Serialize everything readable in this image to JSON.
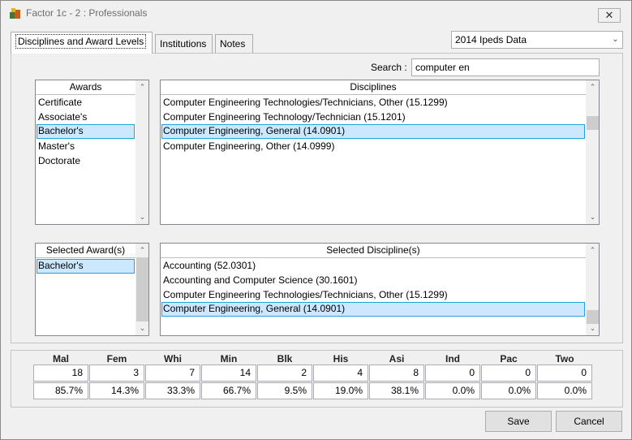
{
  "window": {
    "title": "Factor 1c - 2 : Professionals",
    "close_icon": "close-icon"
  },
  "tabs": [
    {
      "label": "Disciplines and Award Levels",
      "active": true
    },
    {
      "label": "Institutions",
      "active": false
    },
    {
      "label": "Notes",
      "active": false
    }
  ],
  "dataset": {
    "selected": "2014 Ipeds Data"
  },
  "search": {
    "label": "Search :",
    "value": "computer en"
  },
  "awards": {
    "header": "Awards",
    "items": [
      "Certificate",
      "Associate's",
      "Bachelor's",
      "Master's",
      "Doctorate"
    ],
    "selected_index": 2
  },
  "disciplines": {
    "header": "Disciplines",
    "items": [
      "Computer Engineering Technologies/Technicians, Other (15.1299)",
      "Computer Engineering Technology/Technician (15.1201)",
      "Computer Engineering, General (14.0901)",
      "Computer Engineering, Other (14.0999)"
    ],
    "selected_index": 2
  },
  "selected_awards": {
    "header": "Selected Award(s)",
    "items": [
      "Bachelor's"
    ],
    "selected_index": 0
  },
  "selected_disciplines": {
    "header": "Selected Discipline(s)",
    "items": [
      "Accounting (52.0301)",
      "Accounting and Computer Science (30.1601)",
      "Computer Engineering Technologies/Technicians, Other (15.1299)",
      "Computer Engineering, General (14.0901)"
    ],
    "selected_index": 3
  },
  "stats": [
    {
      "label": "Mal",
      "count": "18",
      "pct": "85.7%"
    },
    {
      "label": "Fem",
      "count": "3",
      "pct": "14.3%"
    },
    {
      "label": "Whi",
      "count": "7",
      "pct": "33.3%"
    },
    {
      "label": "Min",
      "count": "14",
      "pct": "66.7%"
    },
    {
      "label": "Blk",
      "count": "2",
      "pct": "9.5%"
    },
    {
      "label": "His",
      "count": "4",
      "pct": "19.0%"
    },
    {
      "label": "Asi",
      "count": "8",
      "pct": "38.1%"
    },
    {
      "label": "Ind",
      "count": "0",
      "pct": "0.0%"
    },
    {
      "label": "Pac",
      "count": "0",
      "pct": "0.0%"
    },
    {
      "label": "Two",
      "count": "0",
      "pct": "0.0%"
    }
  ],
  "buttons": {
    "save": "Save",
    "cancel": "Cancel"
  },
  "colors": {
    "selection_bg": "#cce8ff",
    "selection_border": "#26a0da"
  }
}
